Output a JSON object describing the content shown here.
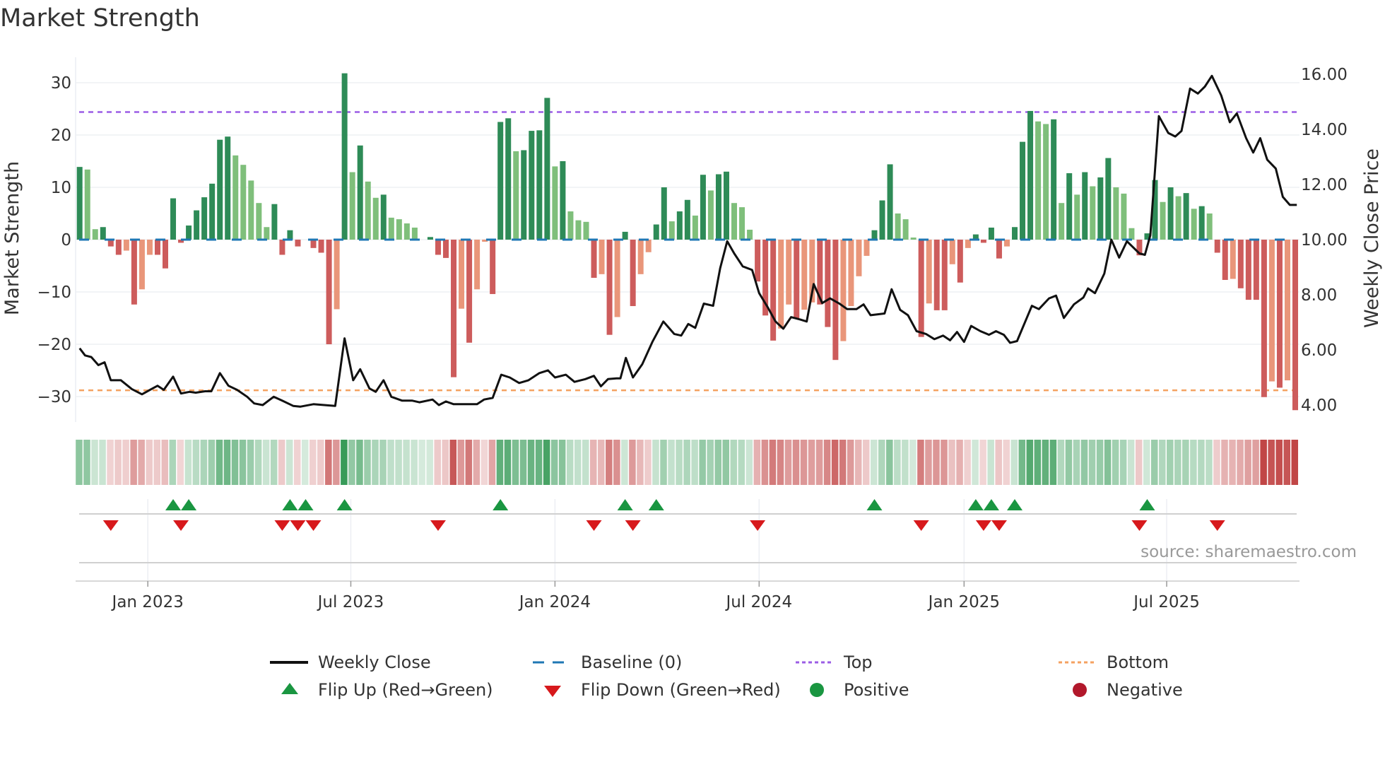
{
  "chart_data": {
    "type": "bar",
    "title": "Market Strength",
    "ylabel": "Market Strength",
    "y2label": "Weekly Close Price",
    "ylim": [
      -35,
      35
    ],
    "y2lim": [
      3.4,
      16.6
    ],
    "yticks": [
      30,
      20,
      10,
      0,
      -10,
      -20,
      -30
    ],
    "ytick_labels": [
      "30",
      "20",
      "10",
      "0",
      "−10",
      "−20",
      "−30"
    ],
    "y2ticks": [
      16,
      14,
      12,
      10,
      8,
      6,
      4
    ],
    "y2tick_labels": [
      "16.00",
      "14.00",
      "12.00",
      "10.00",
      "8.00",
      "6.00",
      "4.00"
    ],
    "xticks": [
      {
        "week": 8.75,
        "label": "Jan 2023"
      },
      {
        "week": 34.8,
        "label": "Jul 2023"
      },
      {
        "week": 61.0,
        "label": "Jan 2024"
      },
      {
        "week": 87.2,
        "label": "Jul 2024"
      },
      {
        "week": 113.5,
        "label": "Jan 2025"
      },
      {
        "week": 139.5,
        "label": "Jul 2025"
      }
    ],
    "top_level": 24.4,
    "bottom_level": -28.8,
    "baseline": 0,
    "strength": [
      13.9,
      13.4,
      2.0,
      2.4,
      -1.3,
      -2.9,
      -2.1,
      -12.4,
      -9.5,
      -2.9,
      -2.9,
      -5.5,
      7.9,
      -0.6,
      2.7,
      5.6,
      8.1,
      10.7,
      19.1,
      19.7,
      16.1,
      14.3,
      11.3,
      7.0,
      2.4,
      6.8,
      -2.9,
      1.8,
      -1.3,
      0,
      -1.6,
      -2.5,
      -20.0,
      -13.3,
      31.8,
      12.9,
      18.0,
      11.1,
      8.0,
      8.6,
      4.2,
      3.9,
      3.1,
      2.3,
      0,
      0.5,
      -2.9,
      -3.5,
      -26.3,
      -13.2,
      -19.7,
      -9.5,
      -0.4,
      -10.4,
      22.5,
      23.2,
      16.9,
      17.1,
      20.8,
      20.9,
      27.1,
      14.0,
      15.0,
      5.4,
      3.7,
      3.4,
      -7.3,
      -6.6,
      -18.2,
      -14.8,
      1.5,
      -12.7,
      -6.6,
      -2.4,
      2.9,
      10.0,
      3.5,
      5.4,
      7.6,
      4.6,
      12.4,
      9.4,
      12.5,
      13.0,
      7.0,
      6.2,
      1.9,
      -8.0,
      -14.5,
      -19.3,
      -17.0,
      -12.4,
      -15.0,
      -13.4,
      -12.0,
      -12.4,
      -16.7,
      -23.0,
      -19.4,
      -12.7,
      -7.0,
      -3.1,
      1.8,
      7.5,
      14.4,
      5.0,
      3.9,
      0.4,
      -18.6,
      -12.2,
      -13.5,
      -13.5,
      -4.7,
      -8.2,
      -1.6,
      1.0,
      -0.6,
      2.3,
      -3.6,
      -1.3,
      2.4,
      18.7,
      24.6,
      22.6,
      22.1,
      23.0,
      7.0,
      12.7,
      8.6,
      12.9,
      10.2,
      11.9,
      15.6,
      10.0,
      8.8,
      2.2,
      -3.0,
      1.2,
      11.4,
      7.2,
      10.0,
      8.3,
      8.9,
      5.9,
      6.4,
      5.0,
      -2.5,
      -7.7,
      -7.5,
      -9.3,
      -11.5,
      -11.5,
      -30.1,
      -27.1,
      -28.3,
      -26.9,
      -32.6
    ],
    "weekly_close": [
      [
        0,
        6.06
      ],
      [
        0.7,
        5.8
      ],
      [
        1.5,
        5.74
      ],
      [
        2.4,
        5.45
      ],
      [
        3.2,
        5.55
      ],
      [
        4.0,
        4.9
      ],
      [
        5.3,
        4.9
      ],
      [
        6.7,
        4.58
      ],
      [
        8.0,
        4.39
      ],
      [
        9.2,
        4.58
      ],
      [
        10.0,
        4.7
      ],
      [
        10.8,
        4.55
      ],
      [
        12.0,
        5.03
      ],
      [
        13.0,
        4.42
      ],
      [
        14.1,
        4.48
      ],
      [
        14.9,
        4.45
      ],
      [
        16.1,
        4.5
      ],
      [
        16.9,
        4.5
      ],
      [
        18.0,
        5.16
      ],
      [
        19.1,
        4.7
      ],
      [
        20.2,
        4.55
      ],
      [
        21.5,
        4.3
      ],
      [
        22.4,
        4.06
      ],
      [
        23.5,
        4.0
      ],
      [
        24.9,
        4.3
      ],
      [
        26.0,
        4.16
      ],
      [
        27.4,
        3.97
      ],
      [
        28.3,
        3.94
      ],
      [
        30.0,
        4.03
      ],
      [
        32.8,
        3.97
      ],
      [
        34.0,
        6.42
      ],
      [
        35.1,
        4.9
      ],
      [
        36.0,
        5.3
      ],
      [
        37.2,
        4.6
      ],
      [
        38.0,
        4.48
      ],
      [
        39.0,
        4.9
      ],
      [
        40.0,
        4.3
      ],
      [
        41.4,
        4.16
      ],
      [
        42.7,
        4.16
      ],
      [
        43.6,
        4.1
      ],
      [
        45.3,
        4.2
      ],
      [
        46.1,
        4.0
      ],
      [
        47.0,
        4.13
      ],
      [
        48.0,
        4.03
      ],
      [
        51.0,
        4.03
      ],
      [
        51.9,
        4.2
      ],
      [
        53.0,
        4.26
      ],
      [
        54.1,
        5.1
      ],
      [
        55.2,
        5.0
      ],
      [
        56.4,
        4.8
      ],
      [
        57.6,
        4.9
      ],
      [
        59.0,
        5.16
      ],
      [
        60.1,
        5.26
      ],
      [
        61.0,
        5.0
      ],
      [
        62.4,
        5.1
      ],
      [
        63.5,
        4.84
      ],
      [
        64.9,
        4.94
      ],
      [
        66.0,
        5.06
      ],
      [
        66.9,
        4.68
      ],
      [
        67.8,
        4.94
      ],
      [
        68.9,
        4.97
      ],
      [
        69.4,
        4.97
      ],
      [
        70.1,
        5.71
      ],
      [
        71.0,
        5.0
      ],
      [
        72.2,
        5.48
      ],
      [
        73.5,
        6.29
      ],
      [
        74.9,
        7.03
      ],
      [
        76.3,
        6.58
      ],
      [
        77.2,
        6.52
      ],
      [
        78.1,
        6.94
      ],
      [
        79.0,
        6.8
      ],
      [
        80.1,
        7.68
      ],
      [
        81.3,
        7.6
      ],
      [
        82.2,
        8.97
      ],
      [
        83.1,
        9.94
      ],
      [
        84.0,
        9.5
      ],
      [
        85.1,
        9.03
      ],
      [
        86.3,
        8.9
      ],
      [
        87.2,
        8.06
      ],
      [
        88.3,
        7.55
      ],
      [
        89.3,
        7.03
      ],
      [
        90.3,
        6.77
      ],
      [
        91.3,
        7.19
      ],
      [
        92.5,
        7.1
      ],
      [
        93.3,
        7.03
      ],
      [
        94.2,
        8.39
      ],
      [
        95.3,
        7.7
      ],
      [
        96.3,
        7.87
      ],
      [
        97.5,
        7.68
      ],
      [
        98.5,
        7.48
      ],
      [
        99.7,
        7.48
      ],
      [
        100.6,
        7.65
      ],
      [
        101.5,
        7.26
      ],
      [
        103.3,
        7.32
      ],
      [
        104.2,
        8.2
      ],
      [
        105.3,
        7.45
      ],
      [
        106.3,
        7.26
      ],
      [
        107.4,
        6.68
      ],
      [
        108.6,
        6.58
      ],
      [
        109.7,
        6.39
      ],
      [
        110.8,
        6.52
      ],
      [
        111.7,
        6.35
      ],
      [
        112.6,
        6.65
      ],
      [
        113.5,
        6.29
      ],
      [
        114.4,
        6.87
      ],
      [
        115.6,
        6.68
      ],
      [
        116.7,
        6.55
      ],
      [
        117.6,
        6.68
      ],
      [
        118.6,
        6.55
      ],
      [
        119.4,
        6.26
      ],
      [
        120.3,
        6.32
      ],
      [
        122.2,
        7.6
      ],
      [
        123.1,
        7.48
      ],
      [
        124.4,
        7.87
      ],
      [
        125.3,
        7.97
      ],
      [
        126.3,
        7.16
      ],
      [
        127.6,
        7.65
      ],
      [
        128.8,
        7.9
      ],
      [
        129.4,
        8.23
      ],
      [
        130.3,
        8.06
      ],
      [
        131.5,
        8.77
      ],
      [
        132.4,
        10.0
      ],
      [
        133.4,
        9.35
      ],
      [
        134.4,
        9.94
      ],
      [
        136.0,
        9.5
      ],
      [
        136.7,
        9.45
      ],
      [
        137.4,
        10.16
      ],
      [
        138.5,
        14.48
      ],
      [
        139.7,
        13.87
      ],
      [
        140.6,
        13.74
      ],
      [
        141.4,
        13.94
      ],
      [
        142.5,
        15.48
      ],
      [
        143.5,
        15.3
      ],
      [
        144.4,
        15.55
      ],
      [
        145.3,
        15.94
      ],
      [
        146.5,
        15.23
      ],
      [
        147.6,
        14.26
      ],
      [
        148.5,
        14.58
      ],
      [
        149.7,
        13.68
      ],
      [
        150.6,
        13.16
      ],
      [
        151.5,
        13.68
      ],
      [
        152.4,
        12.9
      ],
      [
        153.5,
        12.58
      ],
      [
        154.4,
        11.55
      ],
      [
        155.3,
        11.26
      ],
      [
        156.2,
        11.26
      ]
    ],
    "flip_up_weeks": [
      12,
      14,
      27,
      29,
      34,
      54,
      70,
      74,
      102,
      115,
      117,
      120,
      137
    ],
    "flip_down_weeks": [
      4,
      13,
      26,
      28,
      30,
      46,
      66,
      71,
      87,
      108,
      116,
      118,
      136,
      146
    ],
    "colors": {
      "strong_pos": "#2e8b57",
      "weak_pos": "#7fbf7b",
      "strong_neg": "#cd5c5c",
      "weak_neg": "#e9967a",
      "close": "#111111",
      "baseline": "#1f77b4",
      "top": "#9b5de5",
      "bottom": "#f4a261",
      "flip_up": "#1a9641",
      "flip_down": "#d7191c",
      "positive": "#1a9641",
      "negative": "#b2182b"
    },
    "legend": [
      {
        "label": "Weekly Close",
        "symbol": "line"
      },
      {
        "label": "Baseline (0)",
        "symbol": "dash"
      },
      {
        "label": "Top",
        "symbol": "dot-purple"
      },
      {
        "label": "Bottom",
        "symbol": "dot-orange"
      },
      {
        "label": "Flip Up (Red→Green)",
        "symbol": "tri-up"
      },
      {
        "label": "Flip Down (Green→Red)",
        "symbol": "tri-down"
      },
      {
        "label": "Positive",
        "symbol": "circle-green"
      },
      {
        "label": "Negative",
        "symbol": "circle-red"
      }
    ],
    "legend_position": "bottom"
  },
  "source": "source: sharemaestro.com"
}
